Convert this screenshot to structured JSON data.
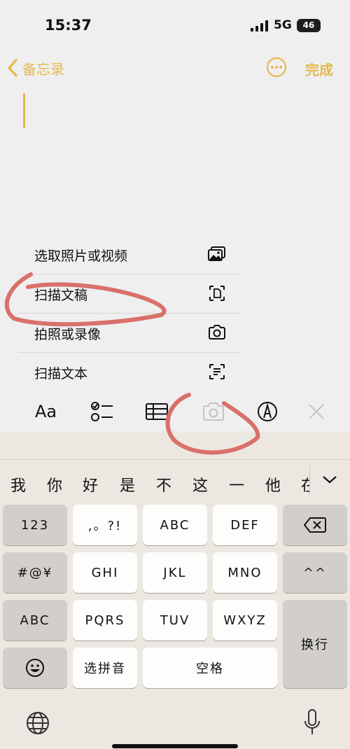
{
  "status_bar": {
    "time": "15:37",
    "network": "5G",
    "battery": "46"
  },
  "nav": {
    "back_label": "备忘录",
    "done_label": "完成"
  },
  "menu": {
    "items": [
      {
        "label": "选取照片或视频",
        "icon": "photo-library-icon"
      },
      {
        "label": "扫描文稿",
        "icon": "scan-document-icon"
      },
      {
        "label": "拍照或录像",
        "icon": "camera-icon"
      },
      {
        "label": "扫描文本",
        "icon": "scan-text-icon"
      }
    ]
  },
  "toolbar": {
    "format_label": "Aa",
    "items": [
      "text-format-icon",
      "checklist-icon",
      "table-icon",
      "camera-icon",
      "markup-pen-icon",
      "close-icon"
    ]
  },
  "keyboard": {
    "candidates": [
      "我",
      "你",
      "好",
      "是",
      "不",
      "这",
      "一",
      "他",
      "在"
    ],
    "rows": [
      [
        "123",
        ",。?!",
        "ABC",
        "DEF",
        "delete"
      ],
      [
        "#@¥",
        "GHI",
        "JKL",
        "MNO",
        "^^"
      ],
      [
        "ABC",
        "PQRS",
        "TUV",
        "WXYZ",
        "换行"
      ],
      [
        "emoji",
        "选拼音",
        "空格"
      ]
    ],
    "bottom": [
      "globe-icon",
      "microphone-icon"
    ]
  },
  "colors": {
    "accent": "#e6b94c",
    "annotation": "#d9706a"
  }
}
